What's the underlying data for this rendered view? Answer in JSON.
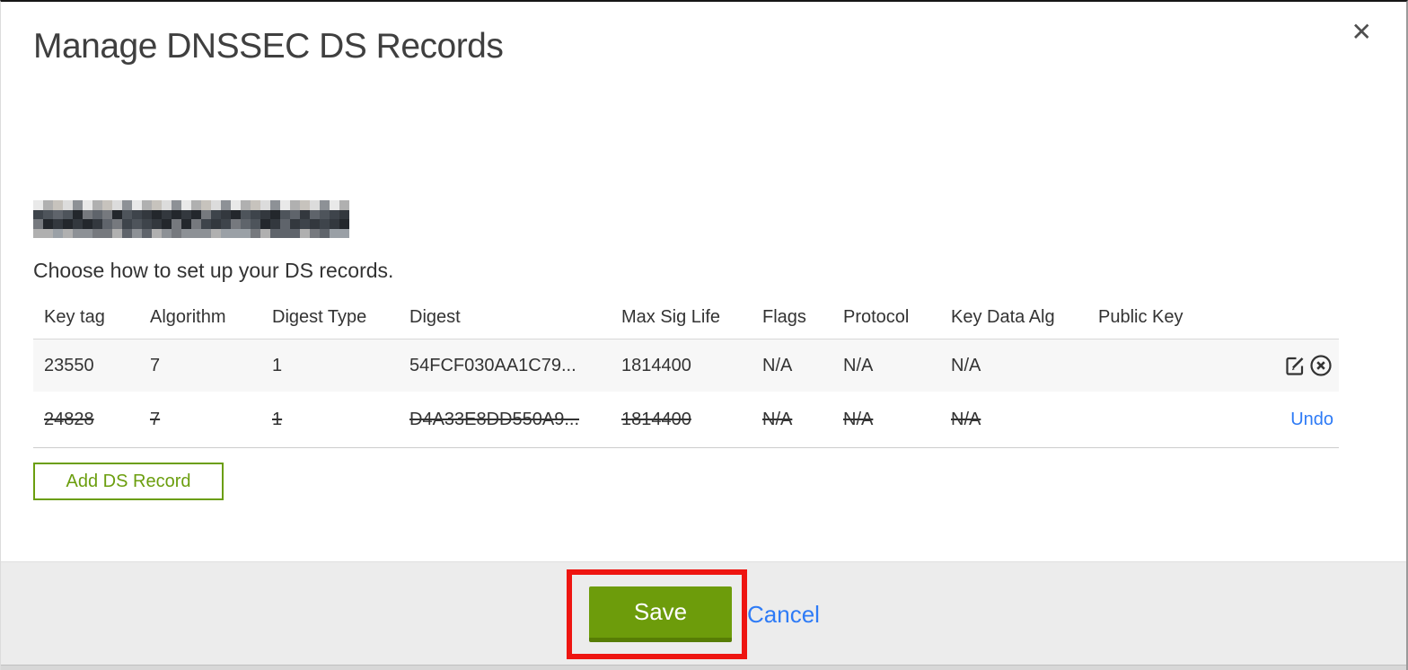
{
  "window": {
    "title": "Manage DNSSEC DS Records",
    "close_icon": "✕"
  },
  "domain": {
    "redacted": true,
    "mosaic": {
      "cols": 32,
      "rows": 4
    }
  },
  "instruction": "Choose how to set up your DS records.",
  "table": {
    "columns": {
      "key_tag": "Key tag",
      "algorithm": "Algorithm",
      "digest_type": "Digest Type",
      "digest": "Digest",
      "max_sig_life": "Max Sig Life",
      "flags": "Flags",
      "protocol": "Protocol",
      "key_data_alg": "Key Data Alg",
      "public_key": "Public Key"
    },
    "rows": [
      {
        "key_tag": "23550",
        "algorithm": "7",
        "digest_type": "1",
        "digest": "54FCF030AA1C79...",
        "max_sig_life": "1814400",
        "flags": "N/A",
        "protocol": "N/A",
        "key_data_alg": "N/A",
        "public_key": "",
        "state": "normal",
        "actions": [
          "edit",
          "delete"
        ]
      },
      {
        "key_tag": "24828",
        "algorithm": "7",
        "digest_type": "1",
        "digest": "D4A33E8DD550A9...",
        "max_sig_life": "1814400",
        "flags": "N/A",
        "protocol": "N/A",
        "key_data_alg": "N/A",
        "public_key": "",
        "state": "deleted",
        "undo_label": "Undo"
      }
    ]
  },
  "buttons": {
    "add_ds_record": "Add DS Record",
    "save": "Save",
    "cancel": "Cancel"
  },
  "annotation": {
    "type": "red-highlight-box",
    "target": "save-button",
    "color": "#ee1511"
  },
  "colors": {
    "accent_green": "#6b9e0e",
    "save_green": "#6d9c0b",
    "save_green_dark": "#577d05",
    "link_blue": "#2e7bf6",
    "footer_gray": "#ececec",
    "row_gray": "#f7f7f7",
    "text_dark": "#333333",
    "redaction_palette": [
      "#e9e9e9",
      "#c7c3bd",
      "#9aa0a6",
      "#76797e",
      "#5f646b",
      "#4e545b",
      "#3e444b",
      "#33383e",
      "#23272c",
      "#8d9196",
      "#b0b0b0",
      "#dcdcdc"
    ]
  }
}
